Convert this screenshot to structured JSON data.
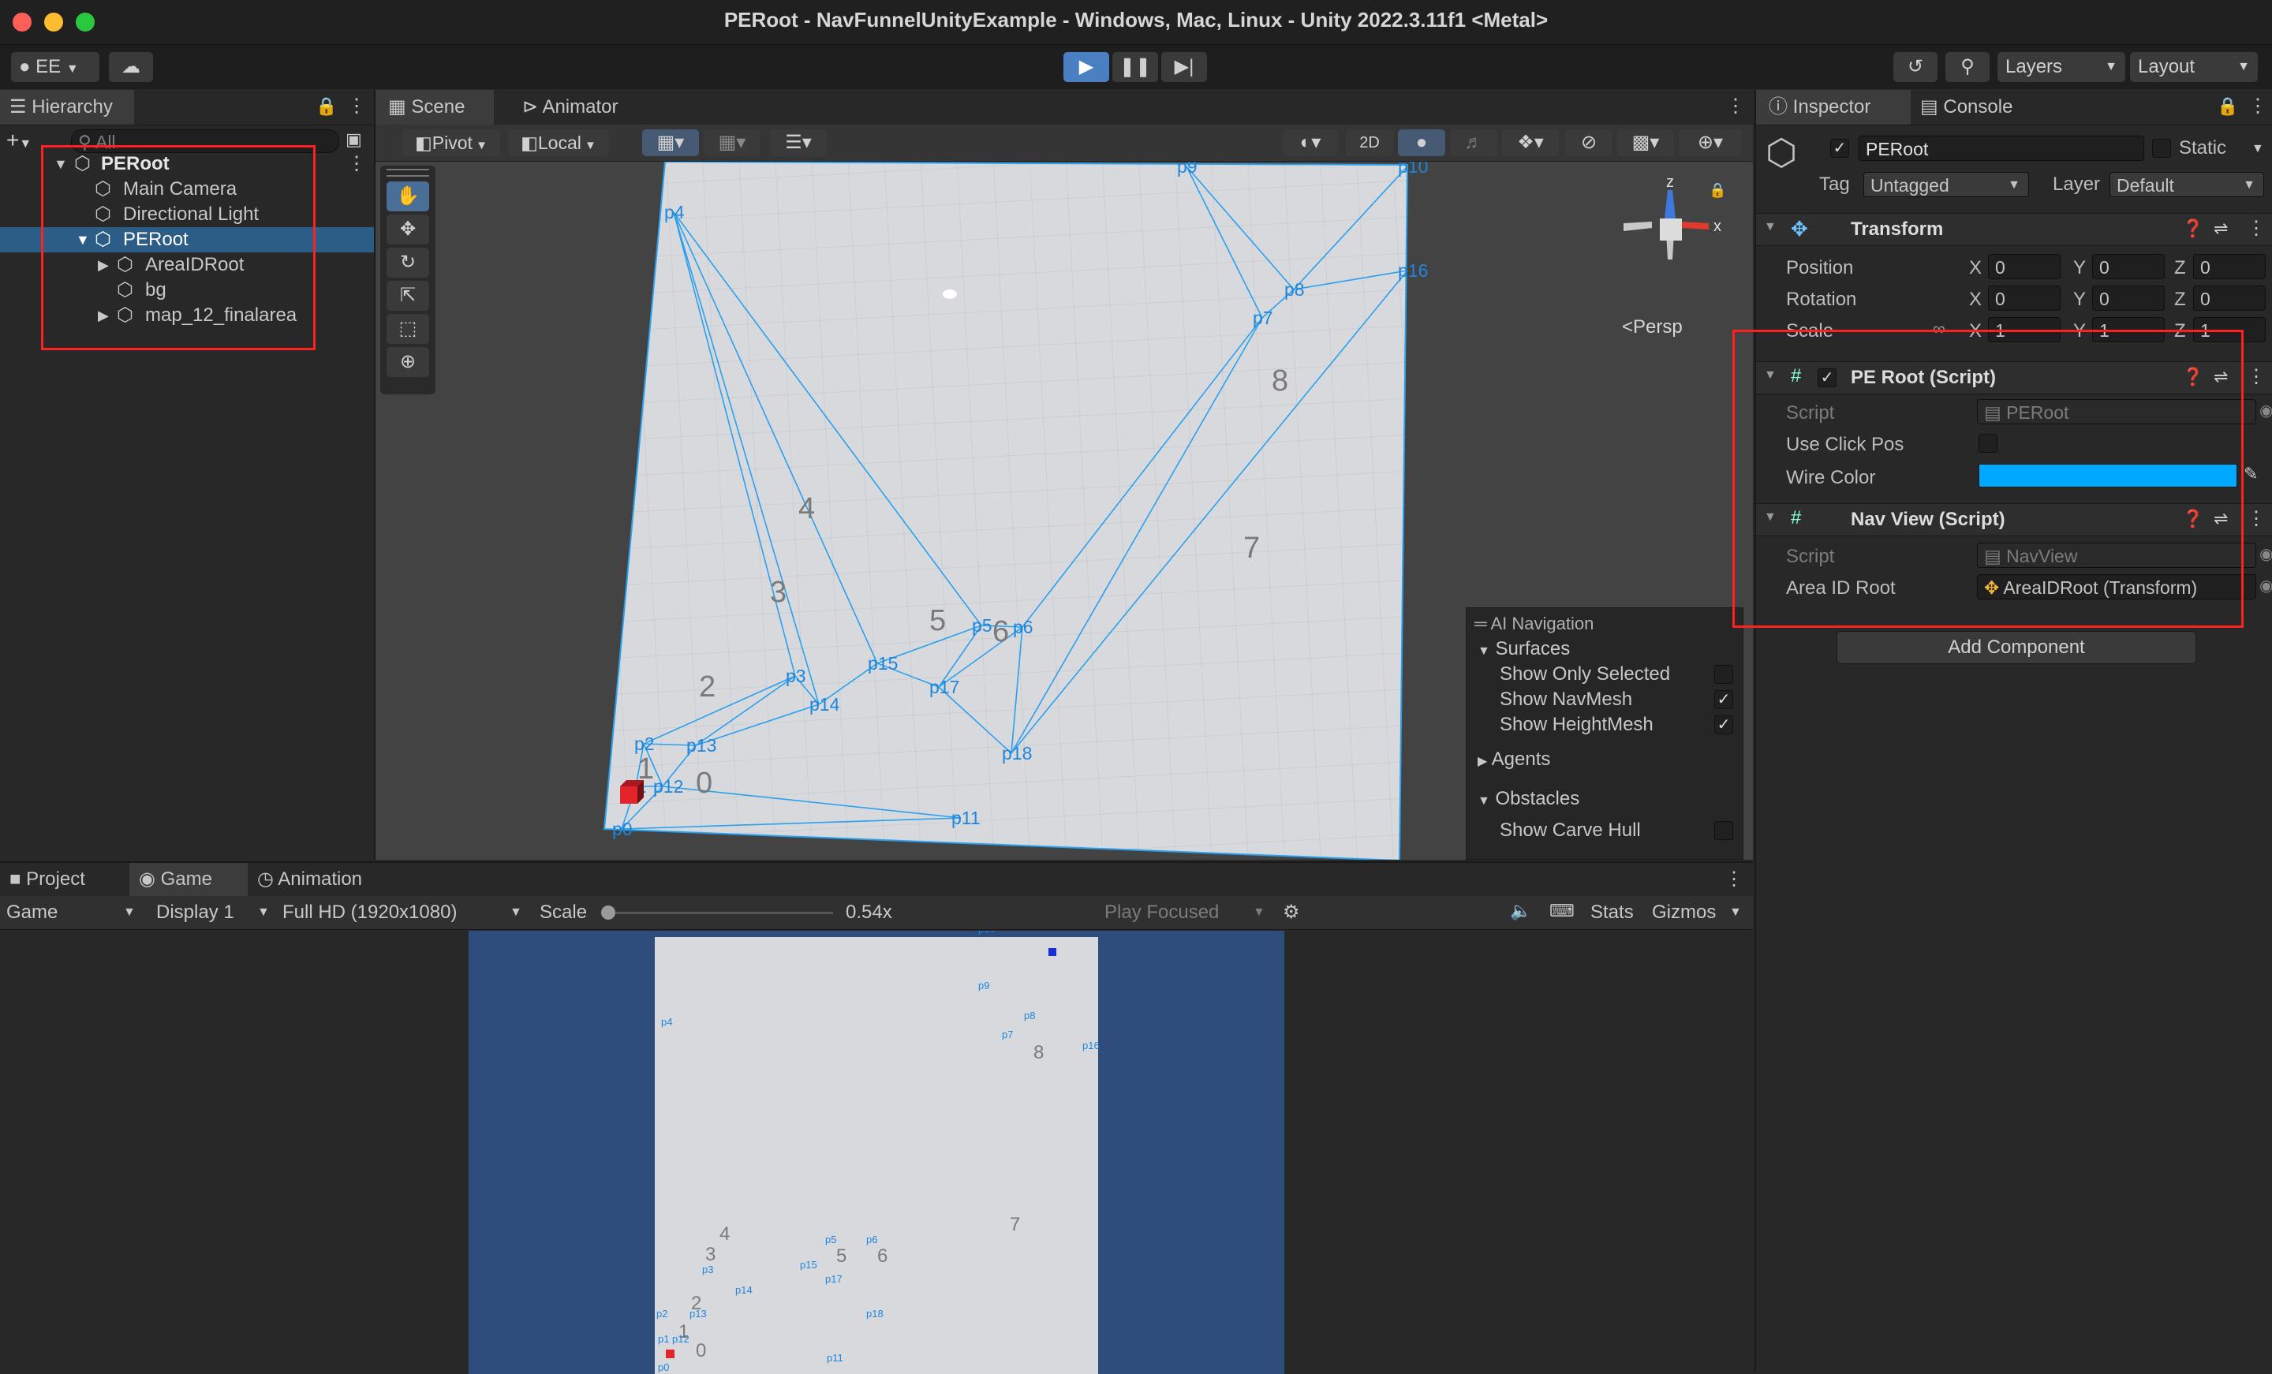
{
  "window": {
    "title": "PERoot - NavFunnelUnityExample - Windows, Mac, Linux - Unity 2022.3.11f1 <Metal>"
  },
  "toolbar": {
    "account": "EE",
    "layers": "Layers",
    "layout": "Layout"
  },
  "hierarchy": {
    "tab": "Hierarchy",
    "search_placeholder": "All",
    "root": "PERoot",
    "children": [
      "Main Camera",
      "Directional Light"
    ],
    "selected": "PERoot",
    "sub_children": [
      "AreaIDRoot",
      "bg",
      "map_12_finalarea"
    ]
  },
  "scene": {
    "tabs": [
      "Scene",
      "Animator"
    ],
    "pivot": "Pivot",
    "local": "Local",
    "mode_2d": "2D",
    "persp": "Persp",
    "gizmo_axes": {
      "z": "z",
      "x": "x"
    },
    "wire_color": "#2aa0ee",
    "areas": [
      "0",
      "1",
      "2",
      "3",
      "4",
      "5",
      "6",
      "7",
      "8"
    ],
    "points": [
      "p0",
      "p1",
      "p2",
      "p3",
      "p4",
      "p5",
      "p6",
      "p7",
      "p8",
      "p9",
      "p10",
      "p11",
      "p12",
      "p13",
      "p14",
      "p15",
      "p16",
      "p17",
      "p18"
    ]
  },
  "ai_navigation": {
    "title": "AI Navigation",
    "surfaces": "Surfaces",
    "show_only_selected": "Show Only Selected",
    "show_navmesh": "Show NavMesh",
    "show_heightmesh": "Show HeightMesh",
    "agents": "Agents",
    "obstacles": "Obstacles",
    "show_carve_hull": "Show Carve Hull"
  },
  "bottom": {
    "tabs": [
      "Project",
      "Game",
      "Animation"
    ],
    "game_view": "Game",
    "display": "Display 1",
    "resolution": "Full HD (1920x1080)",
    "scale_label": "Scale",
    "scale_value": "0.54x",
    "play_focused": "Play Focused",
    "stats": "Stats",
    "gizmos": "Gizmos",
    "viewport_bg": "#2e4d7c"
  },
  "inspector": {
    "tabs": [
      "Inspector",
      "Console"
    ],
    "object_name": "PERoot",
    "static_label": "Static",
    "tag_label": "Tag",
    "tag_value": "Untagged",
    "layer_label": "Layer",
    "layer_value": "Default",
    "transform": {
      "title": "Transform",
      "position_label": "Position",
      "rotation_label": "Rotation",
      "scale_label": "Scale",
      "axis_x": "X",
      "axis_y": "Y",
      "axis_z": "Z",
      "position": [
        "0",
        "0",
        "0"
      ],
      "rotation": [
        "0",
        "0",
        "0"
      ],
      "scale": [
        "1",
        "1",
        "1"
      ]
    },
    "peroot_script": {
      "title": "PE Root (Script)",
      "script_label": "Script",
      "script_value": "PERoot",
      "use_click_pos_label": "Use Click Pos",
      "wire_color_label": "Wire Color",
      "wire_color": "#00a9ff"
    },
    "navview_script": {
      "title": "Nav View (Script)",
      "script_label": "Script",
      "script_value": "NavView",
      "area_id_root_label": "Area ID Root",
      "area_id_root_value": "AreaIDRoot (Transform)"
    },
    "add_component": "Add Component"
  }
}
